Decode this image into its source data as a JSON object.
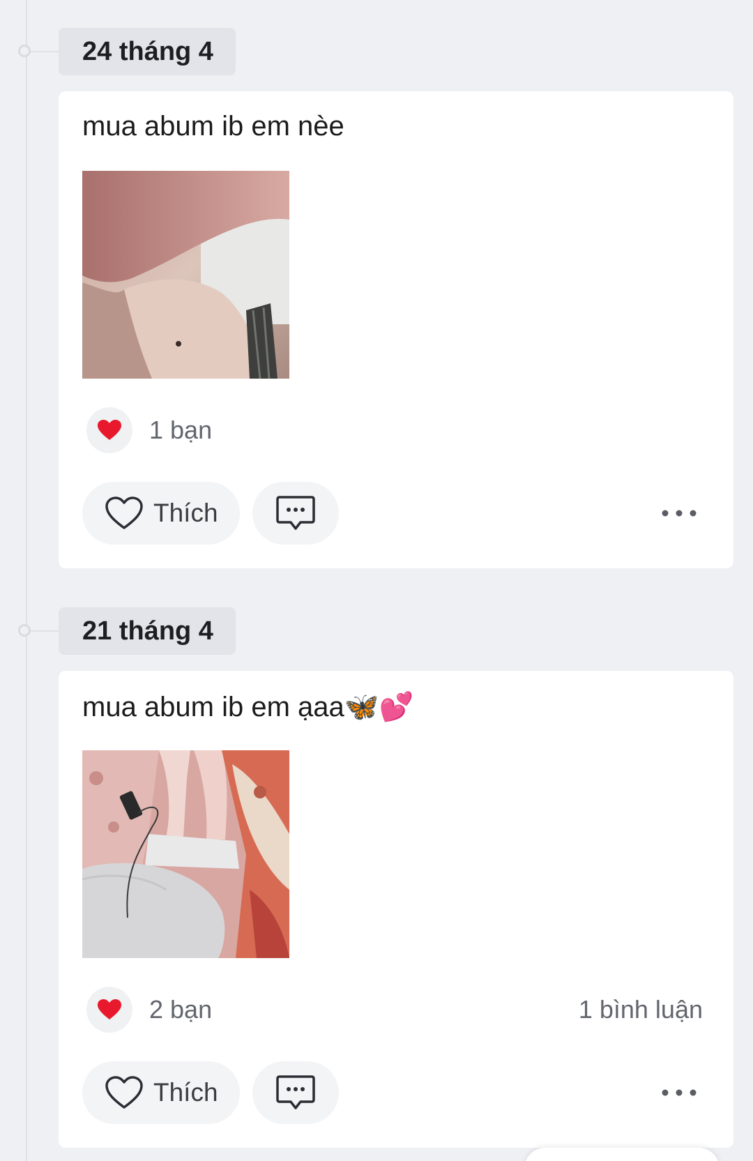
{
  "colors": {
    "background": "#eff0f4",
    "card": "#ffffff",
    "date_pill": "#e2e4e9",
    "heart": "#e8192c",
    "muted_text": "#62656c"
  },
  "posts": [
    {
      "date": "24 tháng 4",
      "text": "mua abum ib em nèe",
      "emoji": "",
      "reaction_icon": "red-heart",
      "reaction_count": "1 bạn",
      "comment_count": "",
      "like_label": "Thích"
    },
    {
      "date": "21 tháng 4",
      "text": "mua abum ib em ạaa",
      "emoji": "🦋💕",
      "reaction_icon": "red-heart",
      "reaction_count": "2 bạn",
      "comment_count": "1 bình luận",
      "like_label": "Thích"
    }
  ]
}
